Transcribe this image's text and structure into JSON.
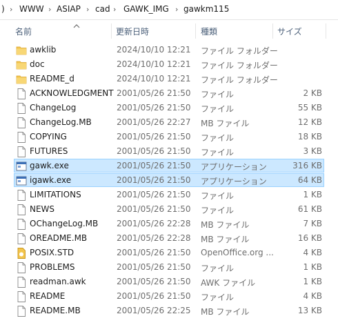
{
  "breadcrumb": {
    "lead": ")",
    "items": [
      "WWW",
      "ASIAP",
      "cad",
      "GAWK_IMG",
      "gawkm115"
    ],
    "separator": "›"
  },
  "columns": {
    "name": "名前",
    "date": "更新日時",
    "type": "種類",
    "size": "サイズ",
    "sort_arrow": "up-chevron-icon"
  },
  "colors": {
    "selection": "#cce8ff",
    "selection_border": "#99d1ff",
    "folder": "#f3c54d",
    "header_text": "#4c607a"
  },
  "files": [
    {
      "name": "awklib",
      "date": "2024/10/10 12:21",
      "type": "ファイル フォルダー",
      "size": "",
      "icon": "folder-icon"
    },
    {
      "name": "doc",
      "date": "2024/10/10 12:21",
      "type": "ファイル フォルダー",
      "size": "",
      "icon": "folder-icon"
    },
    {
      "name": "README_d",
      "date": "2024/10/10 12:21",
      "type": "ファイル フォルダー",
      "size": "",
      "icon": "folder-icon"
    },
    {
      "name": "ACKNOWLEDGMENT",
      "date": "2001/05/26 21:50",
      "type": "ファイル",
      "size": "2 KB",
      "icon": "file-icon"
    },
    {
      "name": "ChangeLog",
      "date": "2001/05/26 21:50",
      "type": "ファイル",
      "size": "55 KB",
      "icon": "file-icon"
    },
    {
      "name": "ChangeLog.MB",
      "date": "2001/05/26 22:27",
      "type": "MB ファイル",
      "size": "12 KB",
      "icon": "file-icon"
    },
    {
      "name": "COPYING",
      "date": "2001/05/26 21:50",
      "type": "ファイル",
      "size": "18 KB",
      "icon": "file-icon"
    },
    {
      "name": "FUTURES",
      "date": "2001/05/26 21:50",
      "type": "ファイル",
      "size": "3 KB",
      "icon": "file-icon"
    },
    {
      "name": "gawk.exe",
      "date": "2001/05/26 21:50",
      "type": "アプリケーション",
      "size": "316 KB",
      "icon": "application-icon",
      "selected": true
    },
    {
      "name": "igawk.exe",
      "date": "2001/05/26 21:50",
      "type": "アプリケーション",
      "size": "64 KB",
      "icon": "application-icon",
      "selected": true
    },
    {
      "name": "LIMITATIONS",
      "date": "2001/05/26 21:50",
      "type": "ファイル",
      "size": "1 KB",
      "icon": "file-icon"
    },
    {
      "name": "NEWS",
      "date": "2001/05/26 21:50",
      "type": "ファイル",
      "size": "61 KB",
      "icon": "file-icon"
    },
    {
      "name": "OChangeLog.MB",
      "date": "2001/05/26 22:28",
      "type": "MB ファイル",
      "size": "7 KB",
      "icon": "file-icon"
    },
    {
      "name": "OREADME.MB",
      "date": "2001/05/26 22:28",
      "type": "MB ファイル",
      "size": "16 KB",
      "icon": "file-icon"
    },
    {
      "name": "POSIX.STD",
      "date": "2001/05/26 21:50",
      "type": "OpenOffice.org ...",
      "size": "4 KB",
      "icon": "openoffice-document-icon"
    },
    {
      "name": "PROBLEMS",
      "date": "2001/05/26 21:50",
      "type": "ファイル",
      "size": "1 KB",
      "icon": "file-icon"
    },
    {
      "name": "readman.awk",
      "date": "2001/05/26 21:50",
      "type": "AWK ファイル",
      "size": "1 KB",
      "icon": "file-icon"
    },
    {
      "name": "README",
      "date": "2001/05/26 21:50",
      "type": "ファイル",
      "size": "4 KB",
      "icon": "file-icon"
    },
    {
      "name": "README.MB",
      "date": "2001/05/26 22:25",
      "type": "MB ファイル",
      "size": "13 KB",
      "icon": "file-icon"
    }
  ]
}
